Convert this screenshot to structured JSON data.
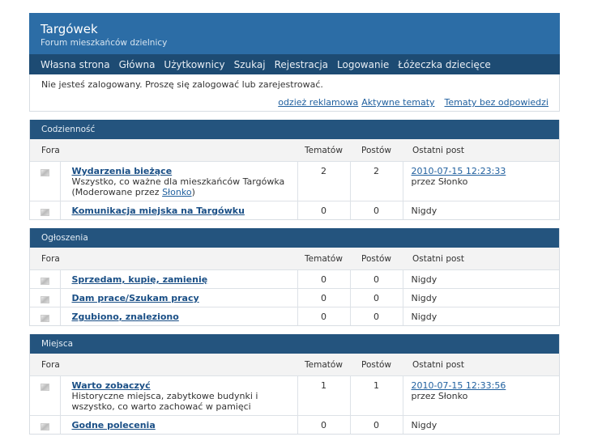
{
  "header": {
    "title": "Targówek",
    "subtitle": "Forum mieszkańców dzielnicy"
  },
  "nav": [
    "Własna strona",
    "Główna",
    "Użytkownicy",
    "Szukaj",
    "Rejestracja",
    "Logowanie",
    "Łóżeczka dziecięce"
  ],
  "notice": {
    "message": "Nie jesteś zalogowany. Proszę się zalogować lub zarejestrować.",
    "links": [
      "odzież reklamowa",
      "Aktywne tematy",
      "Tematy bez odpowiedzi"
    ]
  },
  "columns": {
    "fora": "Fora",
    "topics": "Tematów",
    "posts": "Postów",
    "last": "Ostatni post"
  },
  "categories": [
    {
      "name": "Codzienność",
      "forums": [
        {
          "name": "Wydarzenia bieżące",
          "desc": "Wszystko, co ważne dla mieszkańców Targówka",
          "mod_prefix": "(Moderowane przez ",
          "mod": "Słonko",
          "mod_suffix": ")",
          "topics": "2",
          "posts": "2",
          "last_date": "2010-07-15 12:23:33",
          "last_by": "przez Słonko"
        },
        {
          "name": "Komunikacja miejska na Targówku",
          "topics": "0",
          "posts": "0",
          "last_text": "Nigdy"
        }
      ]
    },
    {
      "name": "Ogłoszenia",
      "forums": [
        {
          "name": "Sprzedam, kupię, zamienię",
          "topics": "0",
          "posts": "0",
          "last_text": "Nigdy"
        },
        {
          "name": "Dam prace/Szukam pracy",
          "topics": "0",
          "posts": "0",
          "last_text": "Nigdy"
        },
        {
          "name": "Zgubiono, znaleziono",
          "topics": "0",
          "posts": "0",
          "last_text": "Nigdy"
        }
      ]
    },
    {
      "name": "Miejsca",
      "forums": [
        {
          "name": "Warto zobaczyć",
          "desc": "Historyczne miejsca, zabytkowe budynki i wszystko, co warto zachować w pamięci",
          "topics": "1",
          "posts": "1",
          "last_date": "2010-07-15 12:33:56",
          "last_by": "przez Słonko"
        },
        {
          "name": "Godne polecenia",
          "topics": "0",
          "posts": "0",
          "last_text": "Nigdy"
        }
      ]
    }
  ]
}
